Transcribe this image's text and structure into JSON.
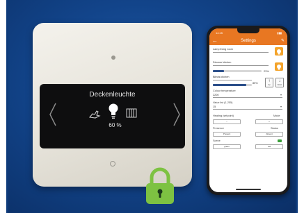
{
  "device": {
    "display_title": "Deckenleuchte",
    "display_value": "60 %",
    "icons": [
      "hand-icon",
      "light-bulb-icon",
      "heater-icon",
      "chevron-left-icon",
      "chevron-right-icon"
    ]
  },
  "lock": {
    "icon": "padlock-icon",
    "color": "#7dc242"
  },
  "phone": {
    "status_time": "14:15",
    "app_title": "Settings",
    "fields": {
      "lamp_name": "Lamp living room",
      "dimmer_name": "Dimmer kitchen",
      "dimmer_percent": "23%",
      "dimmer_level": 0.23,
      "blinds_name": "Blinds kitchen",
      "blinds_percent": "85%",
      "blinds_level": 0.85,
      "up_label": "Up",
      "down_label": "Down",
      "colour_temp_label": "Colour temperature",
      "colour_temp_value": "2200",
      "value_label": "Value list (1-255)",
      "value_value": "15",
      "heating_label": "Heating (setpoint)",
      "mode_label": "Mode",
      "btn_a": "–",
      "btn_b": "+",
      "presence_label": "Presence",
      "status_label": "Status",
      "presence_btn": "Present",
      "status_btn": "Absent",
      "scene_label": "Scene",
      "scene_btn": "green",
      "off_btn": "red"
    }
  },
  "colors": {
    "accent": "#e87722",
    "background": "#12448a",
    "bulb": "#f4a32a"
  }
}
